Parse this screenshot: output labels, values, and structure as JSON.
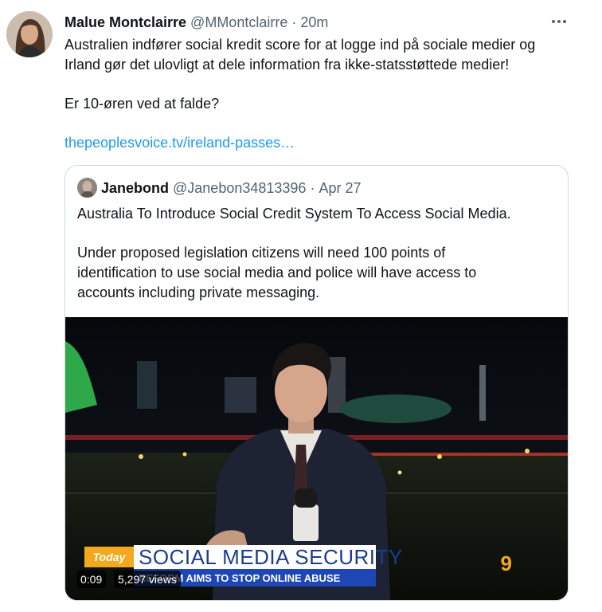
{
  "tweet": {
    "author_name": "Malue Montclairre",
    "author_handle": "@MMontclairre",
    "separator": "·",
    "time": "20m",
    "text_line1": "Australien indfører social kredit score for at logge ind på sociale medier og",
    "text_line2": "Irland gør det ulovligt at dele information fra ikke-statsstøttede medier!",
    "text_line3": "Er 10-øren ved at falde?",
    "link_text": "thepeoplesvoice.tv/ireland-passes…"
  },
  "quote": {
    "author_name": "Janebond",
    "author_handle": "@Janebon34813396",
    "separator": "·",
    "date": "Apr 27",
    "line1": "Australia To Introduce Social Credit System To Access Social Media.",
    "line2": "Under proposed legislation citizens will need 100 points of",
    "line3": "identification to use social media and police will have access to",
    "line4": "accounts including private messaging."
  },
  "video": {
    "duration": "0:09",
    "views": "5,297 views",
    "banner_tag": "Today",
    "banner_title": "SOCIAL MEDIA SECURITY",
    "banner_subtitle": "REFORM AIMS TO STOP ONLINE ABUSE",
    "channel_logo": "9"
  },
  "icons": {
    "more": "more-horizontal-icon"
  }
}
